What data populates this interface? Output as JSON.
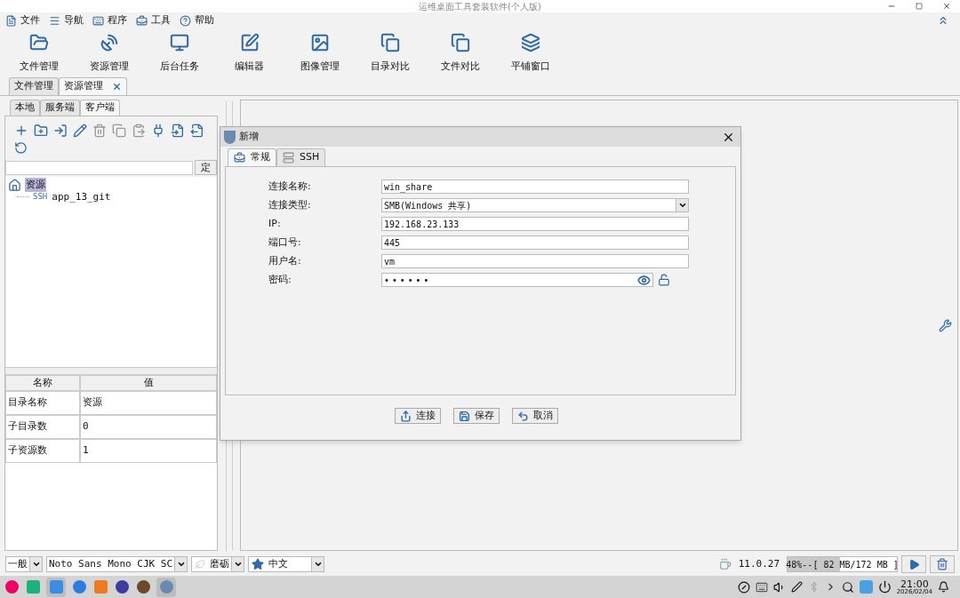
{
  "window": {
    "title": "运维桌面工具套装软件(个人版)"
  },
  "menu": [
    {
      "label": "文件"
    },
    {
      "label": "导航"
    },
    {
      "label": "程序"
    },
    {
      "label": "工具"
    },
    {
      "label": "帮助"
    }
  ],
  "toolbar": [
    {
      "label": "文件管理"
    },
    {
      "label": "资源管理"
    },
    {
      "label": "后台任务"
    },
    {
      "label": "编辑器"
    },
    {
      "label": "图像管理"
    },
    {
      "label": "目录对比"
    },
    {
      "label": "文件对比"
    },
    {
      "label": "平铺窗口"
    }
  ],
  "doc_tabs": [
    {
      "label": "文件管理",
      "selected": false,
      "closable": false
    },
    {
      "label": "资源管理",
      "selected": true,
      "closable": true
    }
  ],
  "side_tabs": [
    {
      "label": "本地",
      "selected": false
    },
    {
      "label": "服务端",
      "selected": false
    },
    {
      "label": "客户端",
      "selected": true
    }
  ],
  "search": {
    "button": "定"
  },
  "tree": [
    {
      "label": "资源",
      "selected": true,
      "children": [
        {
          "badge": "SSH",
          "label": "app_13_git",
          "selected": false
        }
      ]
    }
  ],
  "props": {
    "columns": [
      "名称",
      "值"
    ],
    "rows": [
      [
        "目录名称",
        "资源"
      ],
      [
        "子目录数",
        "0"
      ],
      [
        "子资源数",
        "1"
      ]
    ]
  },
  "dialog": {
    "title": "新增",
    "tabs": [
      {
        "label": "常规",
        "selected": true
      },
      {
        "label": "SSH",
        "selected": false
      }
    ],
    "fields": [
      {
        "label": "连接名称:",
        "value": "win_share",
        "kind": "text"
      },
      {
        "label": "连接类型:",
        "value": "SMB(Windows 共享)",
        "kind": "select"
      },
      {
        "label": "IP:",
        "value": "192.168.23.133",
        "kind": "text"
      },
      {
        "label": "端口号:",
        "value": "445",
        "kind": "text"
      },
      {
        "label": "用户名:",
        "value": "vm",
        "kind": "text"
      },
      {
        "label": "密码:",
        "value": "••••••",
        "kind": "password"
      }
    ],
    "buttons": [
      {
        "label": "连接"
      },
      {
        "label": "保存"
      },
      {
        "label": "取消"
      }
    ]
  },
  "status": {
    "combos": [
      {
        "label": "一般",
        "kind": "plain"
      },
      {
        "label": "Noto Sans Mono CJK SC",
        "kind": "plain"
      },
      {
        "label": "磨砺",
        "kind": "leaf"
      },
      {
        "label": "中文",
        "kind": "star"
      }
    ],
    "java_version": "11.0.27",
    "memory": {
      "text": "48%--[ 82 MB/172 MB ]",
      "level": 0.48
    }
  },
  "taskbar": {
    "time": "21:00",
    "date": "2026/02/04"
  }
}
